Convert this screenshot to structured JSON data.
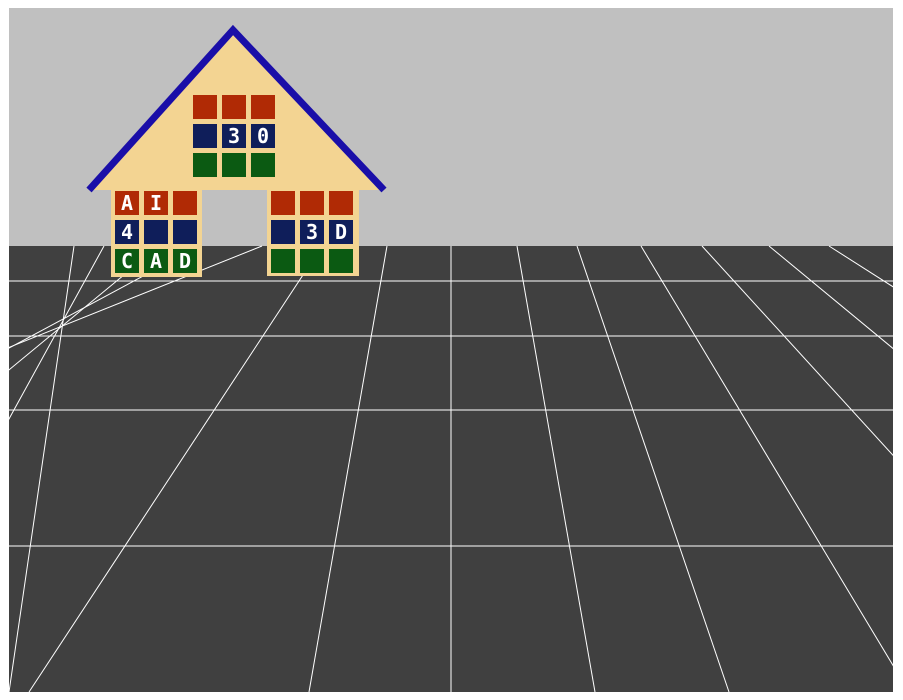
{
  "scene": {
    "sky_color": "#c0c0c0",
    "floor_color": "#404040",
    "grid_color": "#ffffff",
    "house": {
      "wall_color": "#f3d492",
      "roof_color": "#1a0ea8",
      "row_colors": [
        "#b02a05",
        "#0f1e5a",
        "#0b5a12"
      ],
      "roof_block": {
        "red": [
          "",
          "",
          ""
        ],
        "blue": [
          "",
          "3",
          "0"
        ],
        "green": [
          "",
          "",
          ""
        ]
      },
      "left_block": {
        "red": [
          "A",
          "I",
          ""
        ],
        "blue": [
          "4",
          "",
          ""
        ],
        "green": [
          "C",
          "A",
          "D"
        ]
      },
      "right_block": {
        "red": [
          "",
          "",
          ""
        ],
        "blue": [
          "",
          "3",
          "D"
        ],
        "green": [
          "",
          "",
          ""
        ]
      }
    }
  }
}
